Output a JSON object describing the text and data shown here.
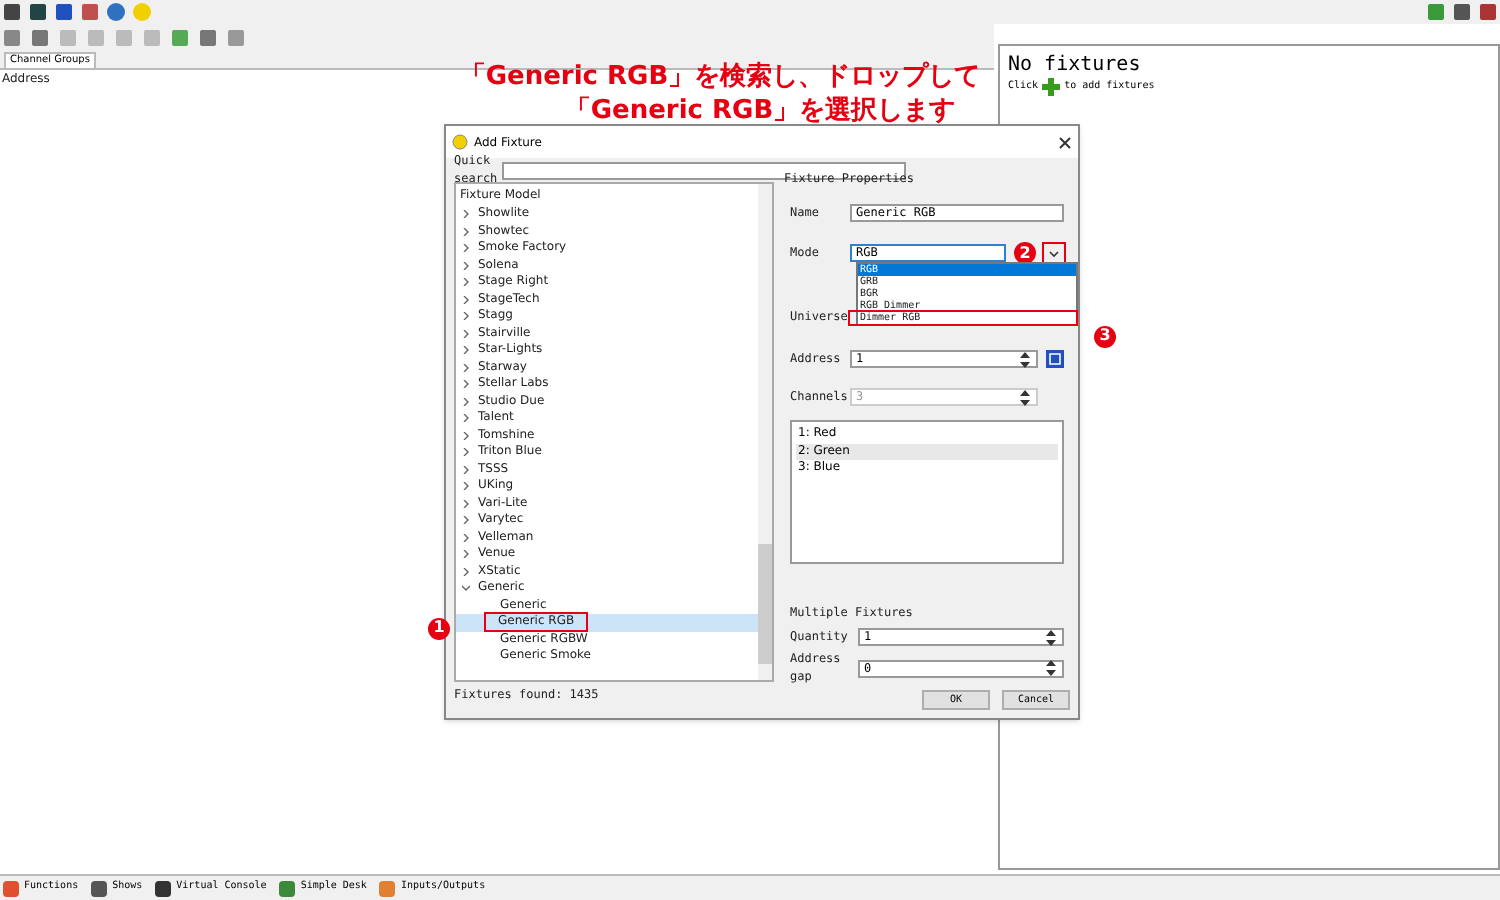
{
  "main_window": {
    "tab": "Channel Groups",
    "column_header": "Address",
    "right_panel": {
      "title": "No fixtures",
      "hint_start": "Click",
      "hint_end": "to add fixtures"
    },
    "bottom_tabs": [
      {
        "label": "Functions"
      },
      {
        "label": "Shows"
      },
      {
        "label": "Virtual Console"
      },
      {
        "label": "Simple Desk"
      },
      {
        "label": "Inputs/Outputs"
      }
    ]
  },
  "annotation": {
    "lines": [
      "「Generic RGB」を検索し、ドロップして",
      "「Generic RGB」を選択します"
    ]
  },
  "dialog": {
    "title": "Add Fixture",
    "quick_search_label": "Quick search",
    "tree_header": "Fixture Model",
    "tree": [
      {
        "label": "Showlite",
        "expanded": false
      },
      {
        "label": "Showtec",
        "expanded": false
      },
      {
        "label": "Smoke Factory",
        "expanded": false
      },
      {
        "label": "Solena",
        "expanded": false
      },
      {
        "label": "Stage Right",
        "expanded": false
      },
      {
        "label": "StageTech",
        "expanded": false
      },
      {
        "label": "Stagg",
        "expanded": false
      },
      {
        "label": "Stairville",
        "expanded": false
      },
      {
        "label": "Star-Lights",
        "expanded": false
      },
      {
        "label": "Starway",
        "expanded": false
      },
      {
        "label": "Stellar Labs",
        "expanded": false
      },
      {
        "label": "Studio Due",
        "expanded": false
      },
      {
        "label": "Talent",
        "expanded": false
      },
      {
        "label": "Tomshine",
        "expanded": false
      },
      {
        "label": "Triton Blue",
        "expanded": false
      },
      {
        "label": "TSSS",
        "expanded": false
      },
      {
        "label": "UKing",
        "expanded": false
      },
      {
        "label": "Vari-Lite",
        "expanded": false
      },
      {
        "label": "Varytec",
        "expanded": false
      },
      {
        "label": "Velleman",
        "expanded": false
      },
      {
        "label": "Venue",
        "expanded": false
      },
      {
        "label": "XStatic",
        "expanded": false
      },
      {
        "label": "Generic",
        "expanded": true,
        "children": [
          {
            "label": "Generic",
            "selected": false,
            "highlighted": false
          },
          {
            "label": "Generic RGB",
            "selected": true,
            "highlighted": true,
            "marker": "1"
          },
          {
            "label": "Generic RGBW",
            "selected": false,
            "highlighted": false
          },
          {
            "label": "Generic Smoke",
            "selected": false,
            "highlighted": false
          }
        ]
      }
    ],
    "fixtures_found": "Fixtures found: 1435",
    "properties_title": "Fixture Properties",
    "name_label": "Name",
    "name_value": "Generic RGB",
    "mode_label": "Mode",
    "mode_value": "RGB",
    "mode_marker": "2",
    "mode_button_highlighted": true,
    "mode_options": [
      {
        "label": "RGB",
        "selected": true,
        "highlighted": false
      },
      {
        "label": "GRB",
        "selected": false,
        "highlighted": false
      },
      {
        "label": "BGR",
        "selected": false,
        "highlighted": false
      },
      {
        "label": "RGB Dimmer",
        "selected": false,
        "highlighted": false
      },
      {
        "label": "Dimmer RGB",
        "selected": false,
        "highlighted": true,
        "marker": "3"
      }
    ],
    "universe_label": "Universe",
    "address_label": "Address",
    "address_value": "1",
    "channels_label": "Channels",
    "channels_value": "3",
    "channels_disabled": true,
    "channels": [
      {
        "label": "1: Red",
        "selected": false
      },
      {
        "label": "2: Green",
        "selected": true
      },
      {
        "label": "3: Blue",
        "selected": false
      }
    ],
    "multiple_title": "Multiple Fixtures",
    "quantity_label": "Quantity",
    "quantity_value": "1",
    "gap_label": "Address gap",
    "gap_value": "0",
    "buttons": [
      "OK",
      "Cancel"
    ]
  }
}
